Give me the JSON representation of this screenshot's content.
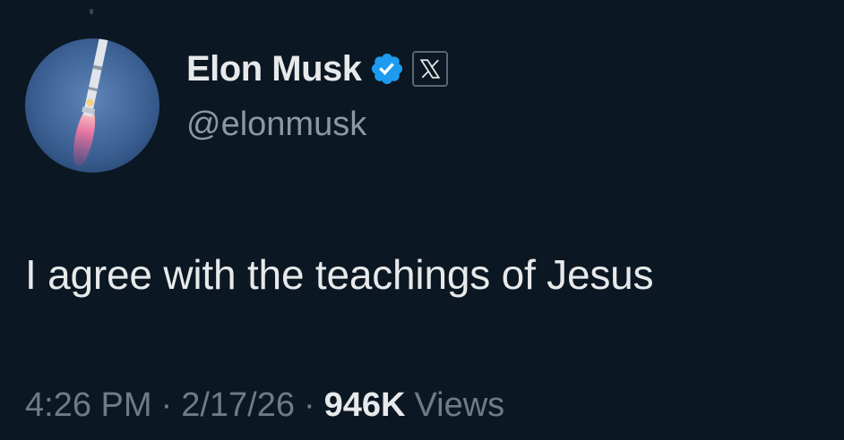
{
  "author": {
    "display_name": "Elon Musk",
    "handle": "@elonmusk",
    "verified_badge_icon": "verified-badge-icon",
    "affiliation_icon": "x-logo-icon",
    "avatar_icon": "rocket-avatar-icon",
    "badge_color": "#1d9bf0"
  },
  "tweet": {
    "text": "I agree with the teachings of Jesus"
  },
  "meta": {
    "time": "4:26 PM",
    "separator": "·",
    "date": "2/17/26",
    "views_count": "946K",
    "views_label": "Views"
  },
  "colors": {
    "background": "#0b1722",
    "primary_text": "#e7e9ea",
    "secondary_text": "#8b98a5"
  }
}
